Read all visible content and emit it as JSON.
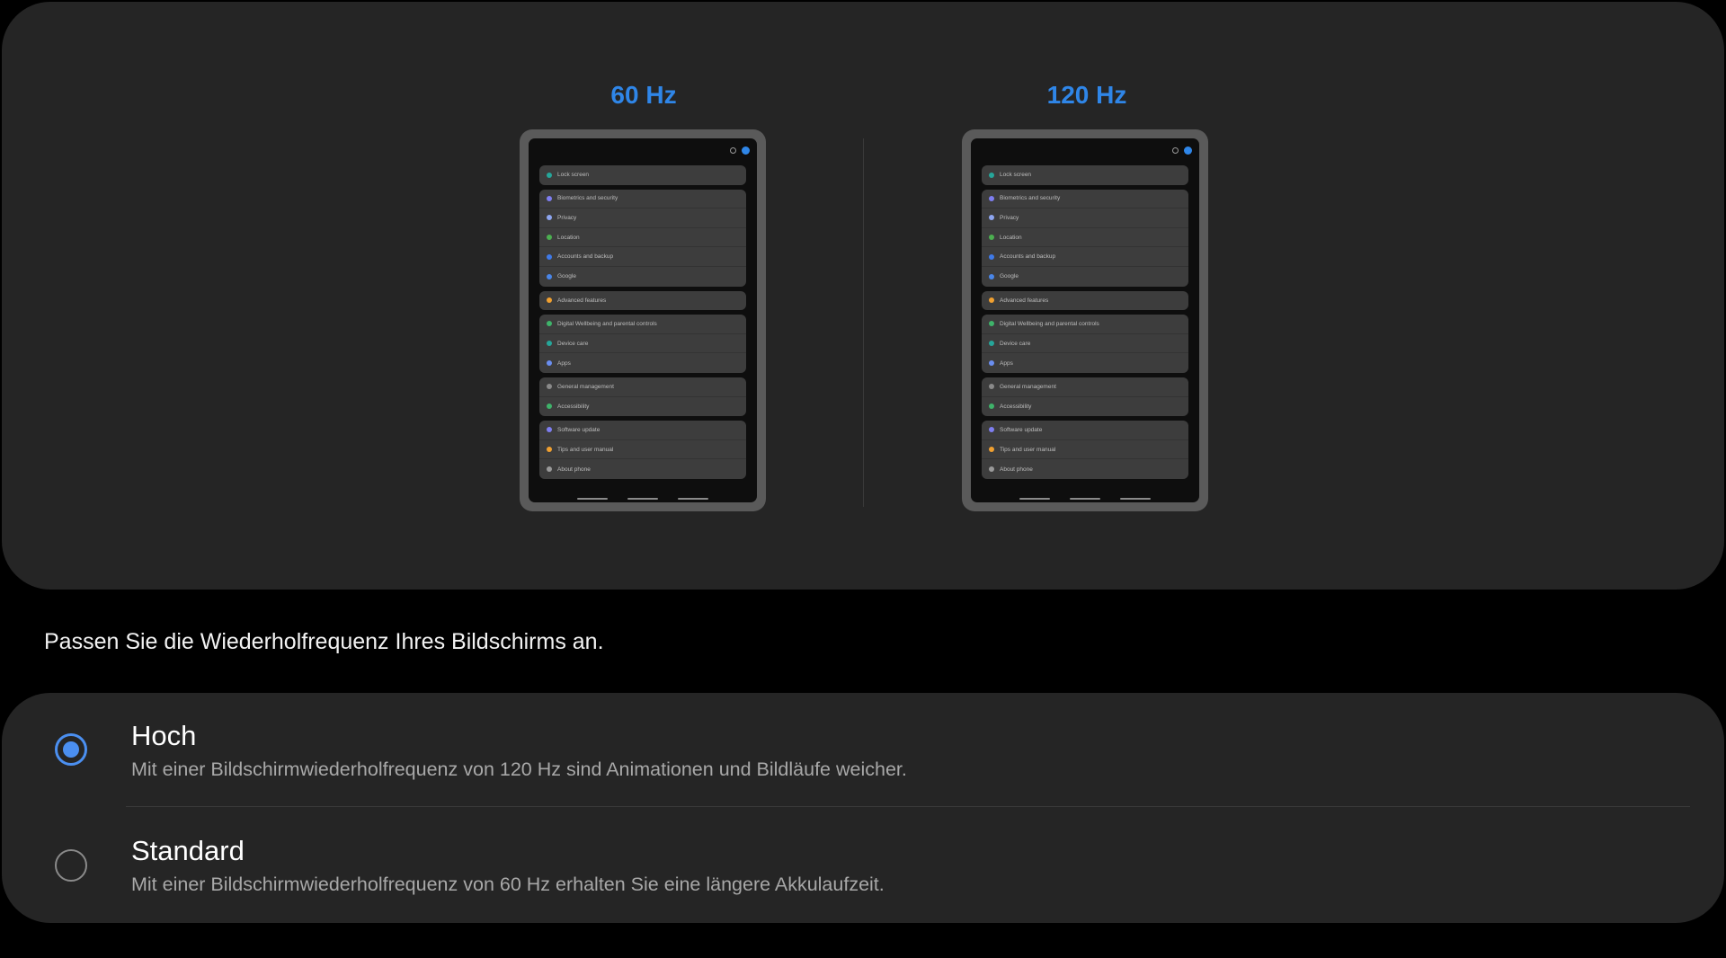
{
  "preview": {
    "left_label": "60 Hz",
    "right_label": "120 Hz",
    "accent_color": "#2f86e8",
    "tablet_groups": [
      [
        {
          "label": "Lock screen",
          "color": "#26a69a"
        }
      ],
      [
        {
          "label": "Biometrics and security",
          "color": "#7e7ef0"
        },
        {
          "label": "Privacy",
          "color": "#8ea6f0"
        },
        {
          "label": "Location",
          "color": "#4caf50"
        },
        {
          "label": "Accounts and backup",
          "color": "#3f7ae8"
        },
        {
          "label": "Google",
          "color": "#4a86e8"
        }
      ],
      [
        {
          "label": "Advanced features",
          "color": "#f0a030"
        }
      ],
      [
        {
          "label": "Digital Wellbeing and parental controls",
          "color": "#3fb36a"
        },
        {
          "label": "Device care",
          "color": "#26a69a"
        },
        {
          "label": "Apps",
          "color": "#6a8ef0"
        }
      ],
      [
        {
          "label": "General management",
          "color": "#8a8a8a"
        },
        {
          "label": "Accessibility",
          "color": "#3fb36a"
        }
      ],
      [
        {
          "label": "Software update",
          "color": "#7e7ef0"
        },
        {
          "label": "Tips and user manual",
          "color": "#f0a030"
        },
        {
          "label": "About phone",
          "color": "#9a9a9a"
        }
      ]
    ]
  },
  "caption": "Passen Sie die Wiederholfrequenz Ihres Bildschirms an.",
  "options": [
    {
      "title": "Hoch",
      "description": "Mit einer Bildschirmwiederholfrequenz von 120 Hz sind Animationen und Bildläufe weicher.",
      "selected": true
    },
    {
      "title": "Standard",
      "description": "Mit einer Bildschirmwiederholfrequenz von 60 Hz erhalten Sie eine längere Akkulaufzeit.",
      "selected": false
    }
  ]
}
